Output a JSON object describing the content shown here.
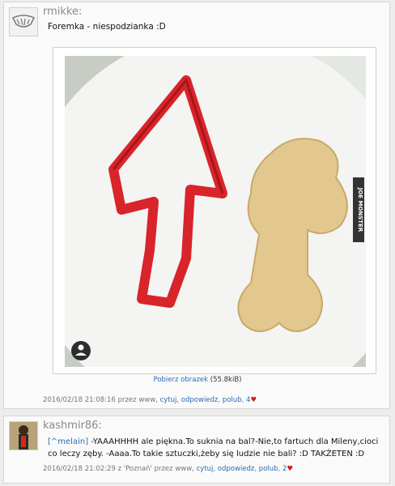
{
  "post1": {
    "username": "rmikke:",
    "text": "Foremka - niespodzianka :D",
    "image_watermark": "JOE MONSTER",
    "download_link": "Pobierz obrazek",
    "download_size": "(55.8kiB)",
    "date": "2016/02/18 21:08:16",
    "via": "przez www,",
    "actions": [
      "cytuj",
      "odpowiedz",
      "polub"
    ],
    "likes": "4"
  },
  "post2": {
    "username": "kashmir86:",
    "quote": "[^melain]",
    "text": " -YAAAHHHH ale piękna.To suknia na bal?-Nie,to fartuch dla Mileny,cioci co leczy zęby. -Aaaa.To takie sztuczki,żeby się ludzie nie bali? :D TAKŻETEN :D",
    "date": "2016/02/18 21:02:29",
    "via": "z 'Poznań' przez www,",
    "actions": [
      "cytuj",
      "odpowiedz",
      "polub"
    ],
    "likes": "2"
  },
  "colors": {
    "link": "#2a6db5",
    "heart": "#d21b1b"
  }
}
